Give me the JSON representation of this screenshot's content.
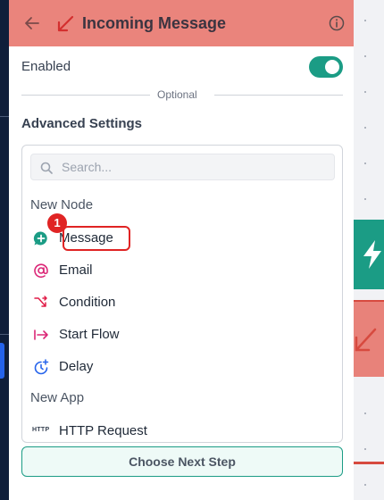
{
  "header": {
    "title": "Incoming Message",
    "color": "#ea847c"
  },
  "enabled": {
    "label": "Enabled",
    "value": true
  },
  "divider": {
    "label": "Optional"
  },
  "advanced": {
    "title": "Advanced Settings"
  },
  "search": {
    "placeholder": "Search...",
    "value": ""
  },
  "groups": [
    {
      "title": "New Node",
      "items": [
        {
          "label": "Message",
          "icon": "whatsapp-plus-icon"
        },
        {
          "label": "Email",
          "icon": "at-sign-icon"
        },
        {
          "label": "Condition",
          "icon": "split-arrows-icon"
        },
        {
          "label": "Start Flow",
          "icon": "arrow-into-bar-icon"
        },
        {
          "label": "Delay",
          "icon": "clock-plus-icon"
        }
      ]
    },
    {
      "title": "New App",
      "items": [
        {
          "label": "HTTP Request",
          "icon": "http-icon"
        }
      ]
    }
  ],
  "http_icon_text": "HTTP",
  "annotation": {
    "badge": "1"
  },
  "footer": {
    "button_label": "Choose Next Step"
  },
  "colors": {
    "accent": "#1b9c85",
    "highlight": "#e02424",
    "header_bg": "#ea847c"
  }
}
